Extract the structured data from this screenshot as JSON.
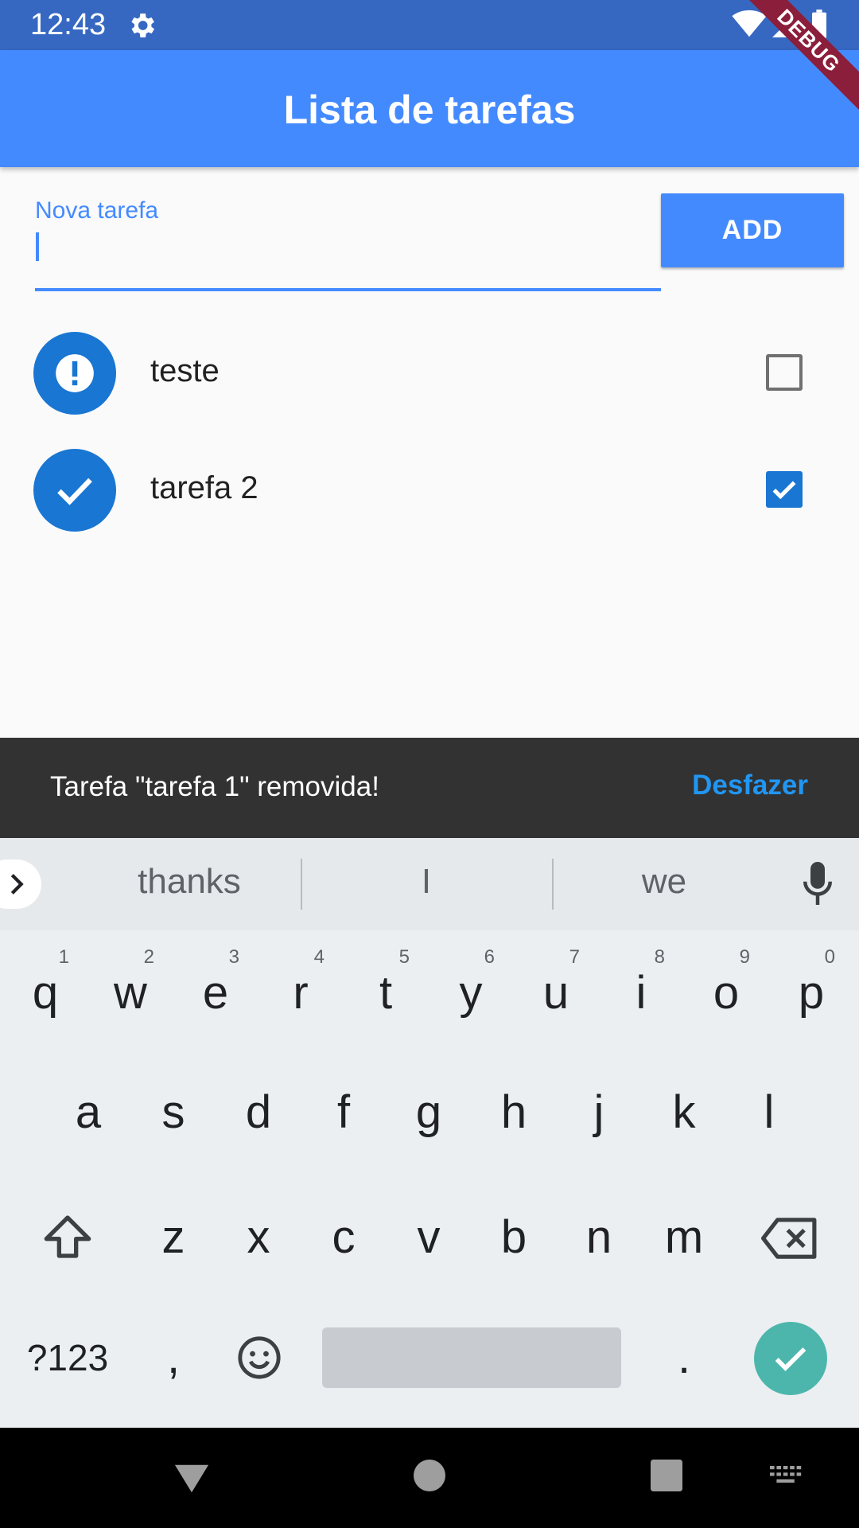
{
  "status_bar": {
    "time": "12:43"
  },
  "app_bar": {
    "title": "Lista de tarefas",
    "debug_label": "DEBUG"
  },
  "new_task": {
    "label": "Nova tarefa",
    "value": "",
    "add_label": "ADD"
  },
  "tasks": [
    {
      "label": "teste",
      "done": false,
      "icon": "exclamation-icon"
    },
    {
      "label": "tarefa 2",
      "done": true,
      "icon": "check-icon"
    }
  ],
  "snackbar": {
    "message": "Tarefa \"tarefa 1\" removida!",
    "action": "Desfazer"
  },
  "keyboard": {
    "suggestions": [
      "thanks",
      "I",
      "we"
    ],
    "row1": [
      {
        "k": "q",
        "h": "1"
      },
      {
        "k": "w",
        "h": "2"
      },
      {
        "k": "e",
        "h": "3"
      },
      {
        "k": "r",
        "h": "4"
      },
      {
        "k": "t",
        "h": "5"
      },
      {
        "k": "y",
        "h": "6"
      },
      {
        "k": "u",
        "h": "7"
      },
      {
        "k": "i",
        "h": "8"
      },
      {
        "k": "o",
        "h": "9"
      },
      {
        "k": "p",
        "h": "0"
      }
    ],
    "row2": [
      "a",
      "s",
      "d",
      "f",
      "g",
      "h",
      "j",
      "k",
      "l"
    ],
    "row3": [
      "z",
      "x",
      "c",
      "v",
      "b",
      "n",
      "m"
    ],
    "symbols_label": "?123",
    "comma": ",",
    "period": "."
  },
  "colors": {
    "primary": "#448aff",
    "status_bar": "#3668c2",
    "accent": "#1976d2",
    "enter": "#4db6ac"
  }
}
